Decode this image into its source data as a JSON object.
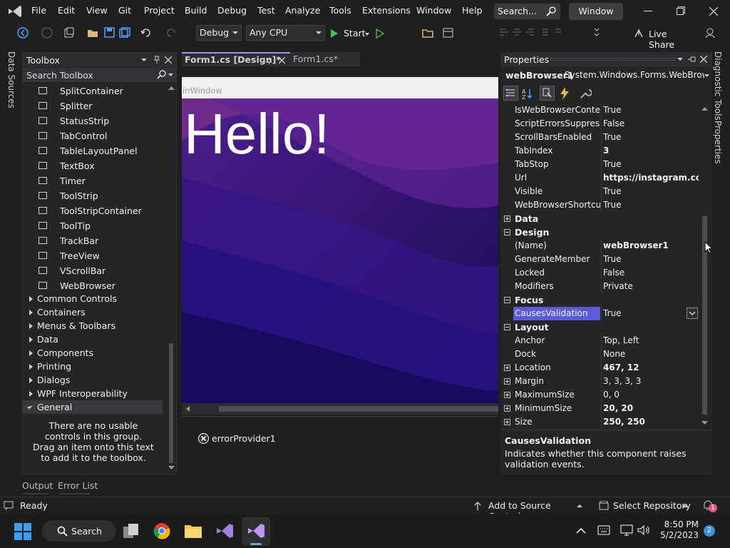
{
  "menu": [
    "File",
    "Edit",
    "View",
    "Git",
    "Project",
    "Build",
    "Debug",
    "Test",
    "Analyze",
    "Tools",
    "Extensions",
    "Window",
    "Help"
  ],
  "search": {
    "label": "Search..."
  },
  "window_title": "Window",
  "toolbar": {
    "config": "Debug",
    "platform": "Any CPU",
    "start_label": "Start",
    "live_share": "Live Share"
  },
  "left_rail": {
    "data_sources": "Data Sources"
  },
  "right_rail": {
    "diagnostic_tools": "Diagnostic Tools",
    "properties": "Properties"
  },
  "toolbox": {
    "title": "Toolbox",
    "search_placeholder": "Search Toolbox",
    "items": [
      {
        "label": "SplitContainer",
        "icon": "split-container-icon"
      },
      {
        "label": "Splitter",
        "icon": "splitter-icon"
      },
      {
        "label": "StatusStrip",
        "icon": "status-strip-icon"
      },
      {
        "label": "TabControl",
        "icon": "tab-control-icon"
      },
      {
        "label": "TableLayoutPanel",
        "icon": "table-layout-icon"
      },
      {
        "label": "TextBox",
        "icon": "textbox-icon"
      },
      {
        "label": "Timer",
        "icon": "timer-icon"
      },
      {
        "label": "ToolStrip",
        "icon": "toolstrip-icon"
      },
      {
        "label": "ToolStripContainer",
        "icon": "toolstrip-container-icon"
      },
      {
        "label": "ToolTip",
        "icon": "tooltip-icon"
      },
      {
        "label": "TrackBar",
        "icon": "trackbar-icon"
      },
      {
        "label": "TreeView",
        "icon": "treeview-icon"
      },
      {
        "label": "VScrollBar",
        "icon": "vscrollbar-icon"
      },
      {
        "label": "WebBrowser",
        "icon": "webbrowser-icon"
      }
    ],
    "groups": [
      "Common Controls",
      "Containers",
      "Menus & Toolbars",
      "Data",
      "Components",
      "Printing",
      "Dialogs",
      "WPF Interoperability"
    ],
    "general_group": "General",
    "empty_message": "There are no usable controls in this group. Drag an item onto this text to add it to the toolbox."
  },
  "doc_tabs": [
    {
      "label": "Form1.cs [Design]*",
      "active": true
    },
    {
      "label": "Form1.cs*",
      "active": false
    }
  ],
  "designer": {
    "form_title": "inWindow",
    "hello_text": "Hello!",
    "component_tray_item": "errorProvider1"
  },
  "properties": {
    "title": "Properties",
    "object_name": "webBrowser1",
    "object_type": "System.Windows.Forms.WebBrowse",
    "rows": [
      {
        "kind": "prop",
        "name": "IsWebBrowserContextMenuEnabled",
        "value": "True",
        "bold": false
      },
      {
        "kind": "prop",
        "name": "ScriptErrorsSuppressed",
        "value": "False",
        "bold": false
      },
      {
        "kind": "prop",
        "name": "ScrollBarsEnabled",
        "value": "True",
        "bold": false
      },
      {
        "kind": "prop",
        "name": "TabIndex",
        "value": "3",
        "bold": true
      },
      {
        "kind": "prop",
        "name": "TabStop",
        "value": "True",
        "bold": false
      },
      {
        "kind": "prop",
        "name": "Url",
        "value": "https://instagram.com/t",
        "bold": true
      },
      {
        "kind": "prop",
        "name": "Visible",
        "value": "True",
        "bold": false
      },
      {
        "kind": "prop",
        "name": "WebBrowserShortcutsEnabled",
        "value": "True",
        "bold": false
      },
      {
        "kind": "cat",
        "name": "Data",
        "expanded": false
      },
      {
        "kind": "cat",
        "name": "Design",
        "expanded": true
      },
      {
        "kind": "prop",
        "name": "(Name)",
        "value": "webBrowser1",
        "bold": true
      },
      {
        "kind": "prop",
        "name": "GenerateMember",
        "value": "True",
        "bold": false
      },
      {
        "kind": "prop",
        "name": "Locked",
        "value": "False",
        "bold": false
      },
      {
        "kind": "prop",
        "name": "Modifiers",
        "value": "Private",
        "bold": false
      },
      {
        "kind": "cat",
        "name": "Focus",
        "expanded": true
      },
      {
        "kind": "prop",
        "name": "CausesValidation",
        "value": "True",
        "bold": false,
        "selected": true
      },
      {
        "kind": "cat",
        "name": "Layout",
        "expanded": true
      },
      {
        "kind": "prop",
        "name": "Anchor",
        "value": "Top, Left",
        "bold": false
      },
      {
        "kind": "prop",
        "name": "Dock",
        "value": "None",
        "bold": false
      },
      {
        "kind": "prop",
        "name": "Location",
        "value": "467, 12",
        "bold": true,
        "expandable": true
      },
      {
        "kind": "prop",
        "name": "Margin",
        "value": "3, 3, 3, 3",
        "bold": false,
        "expandable": true
      },
      {
        "kind": "prop",
        "name": "MaximumSize",
        "value": "0, 0",
        "bold": false,
        "expandable": true
      },
      {
        "kind": "prop",
        "name": "MinimumSize",
        "value": "20, 20",
        "bold": true,
        "expandable": true
      },
      {
        "kind": "prop",
        "name": "Size",
        "value": "250, 250",
        "bold": true,
        "expandable": true
      }
    ],
    "description_title": "CausesValidation",
    "description_text": "Indicates whether this component raises validation events."
  },
  "bottom_tabs": [
    "Output",
    "Error List"
  ],
  "status": {
    "ready": "Ready",
    "add_source": "Add to Source Control",
    "select_repo": "Select Repository",
    "notification_count": "1"
  },
  "taskbar": {
    "search_label": "Search",
    "time": "8:50 PM",
    "date": "5/2/2023",
    "badge": "2"
  },
  "colors": {
    "accent": "#1e90ff",
    "vs_purple": "#8661c5",
    "selection": "#5a5adb"
  }
}
